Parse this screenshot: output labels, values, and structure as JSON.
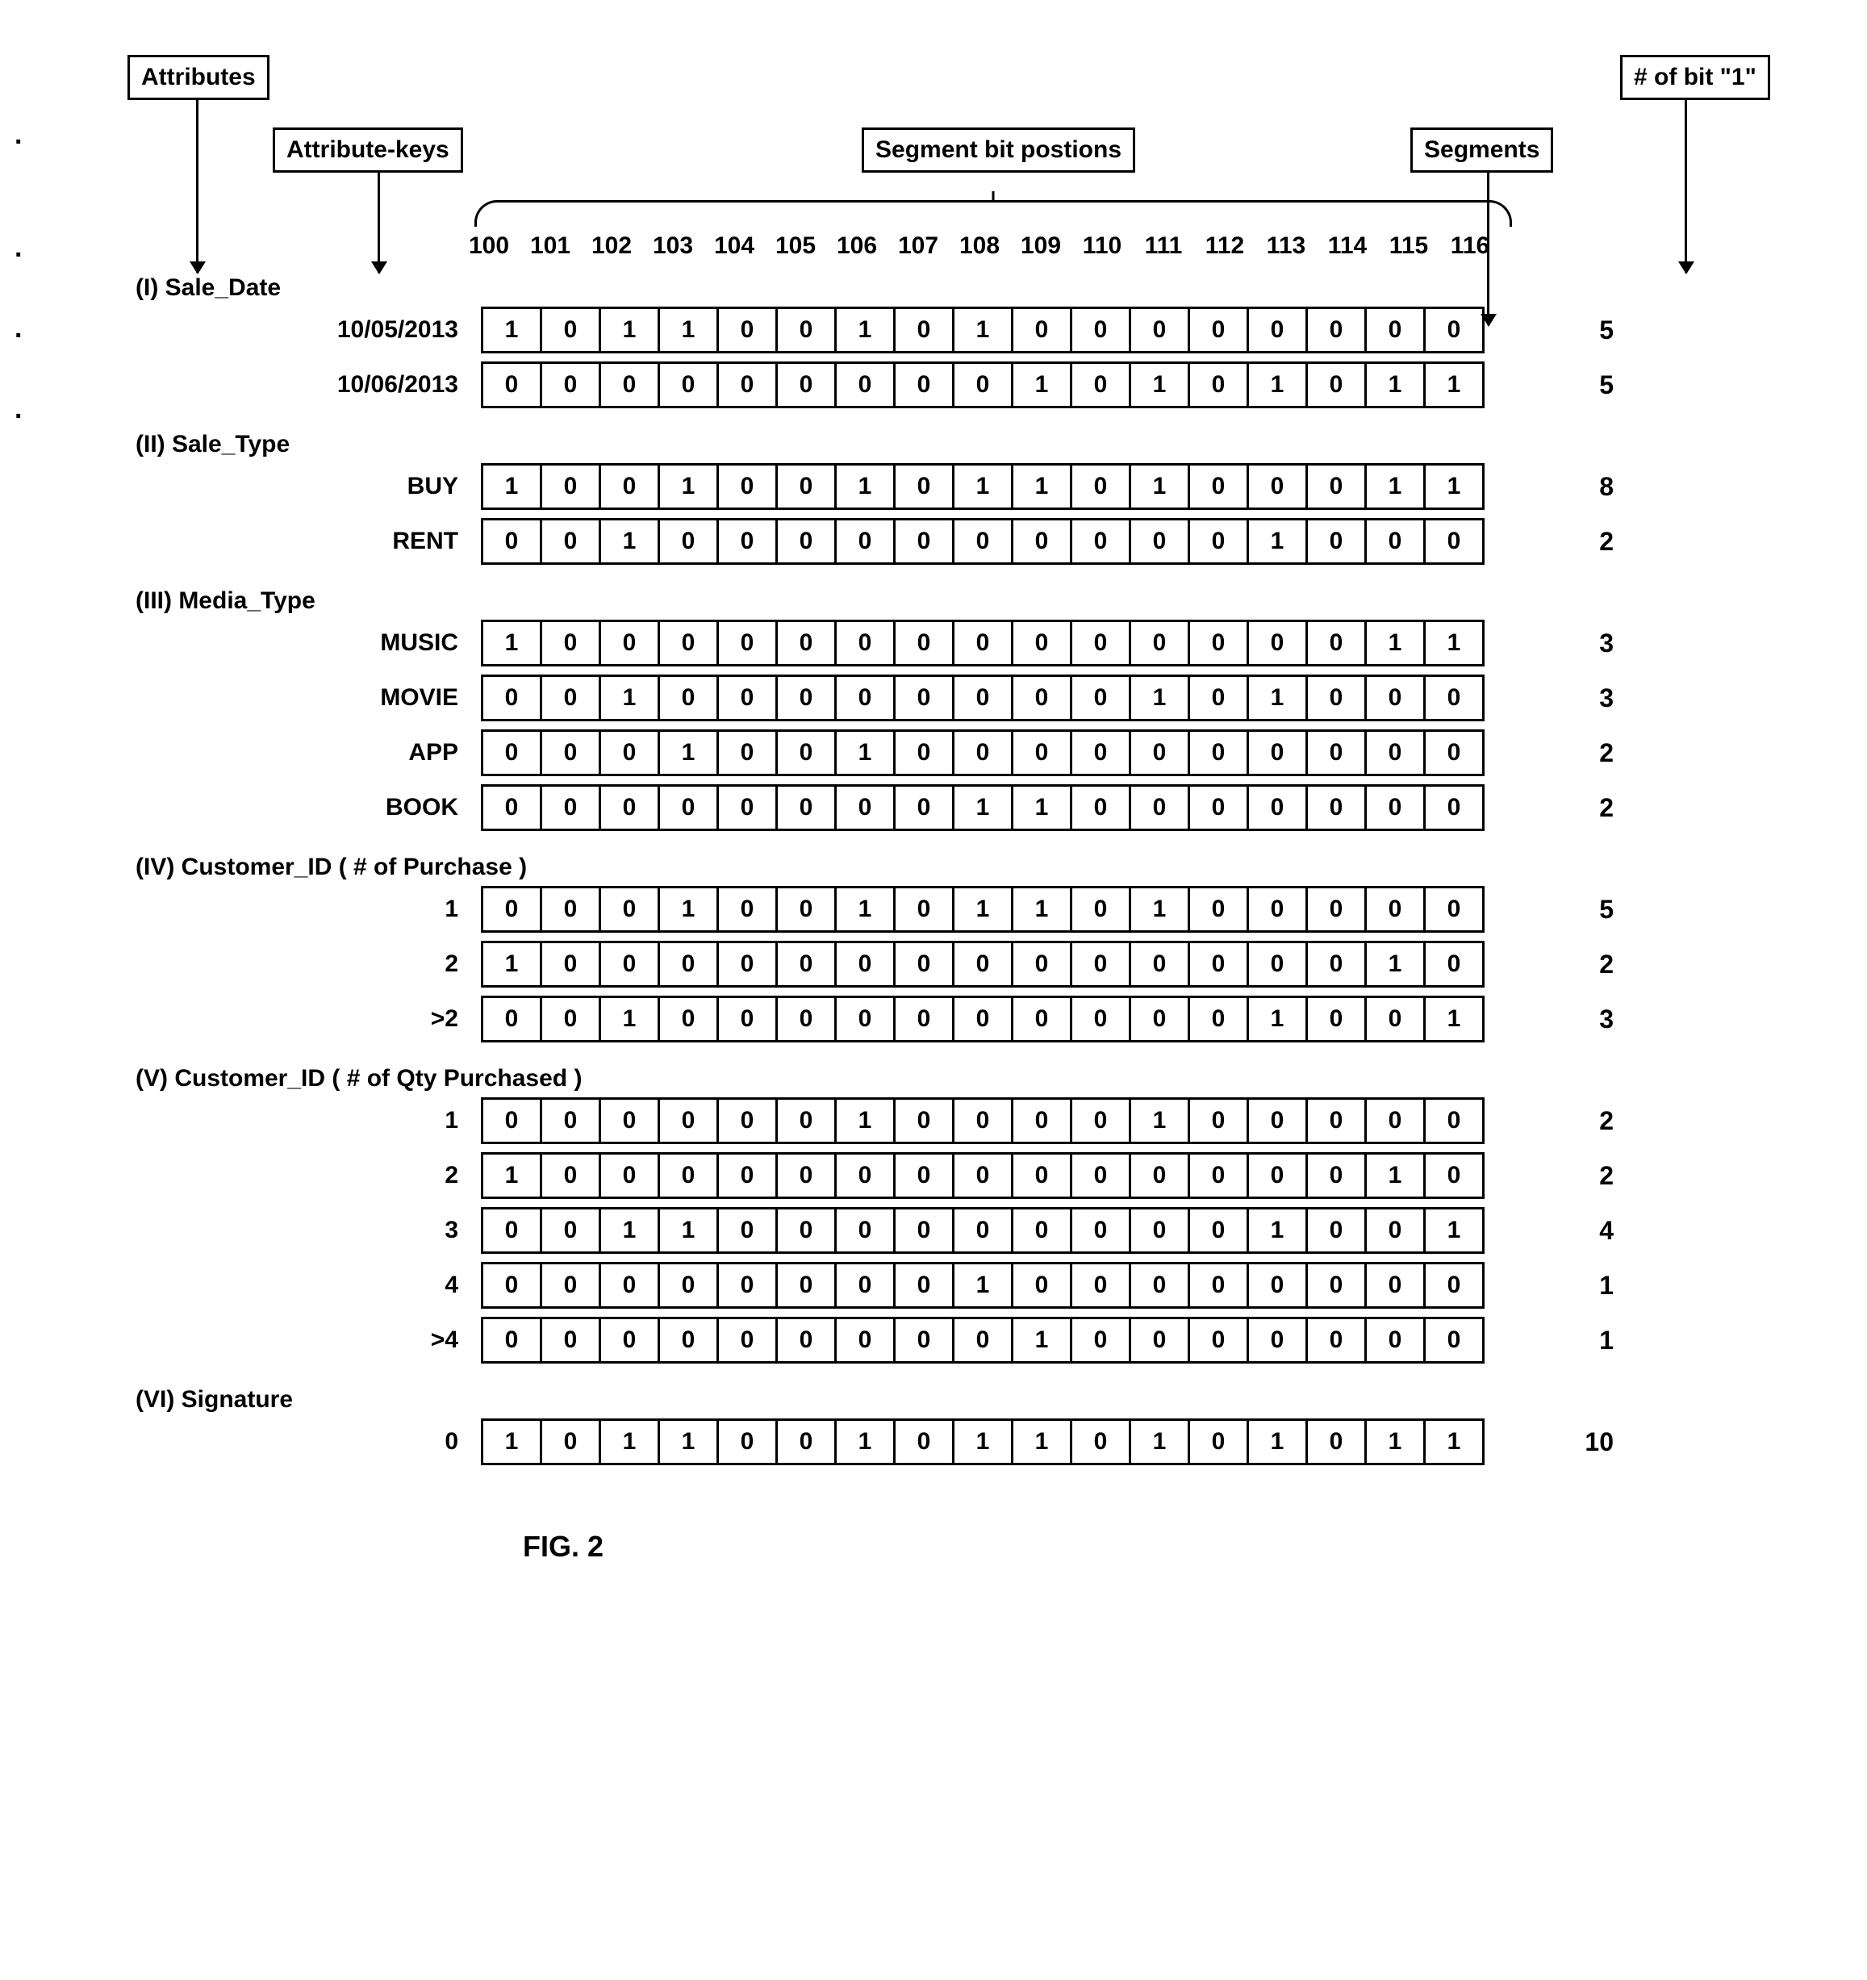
{
  "labels": {
    "attributes": "Attributes",
    "attribute_keys": "Attribute-keys",
    "segment_bit_positions": "Segment bit postions",
    "segments": "Segments",
    "bit_count": "# of bit \"1\""
  },
  "positions": [
    "100",
    "101",
    "102",
    "103",
    "104",
    "105",
    "106",
    "107",
    "108",
    "109",
    "110",
    "111",
    "112",
    "113",
    "114",
    "115",
    "116"
  ],
  "groups": [
    {
      "title": "(I) Sale_Date",
      "rows": [
        {
          "key": "10/05/2013",
          "bits": [
            1,
            0,
            1,
            1,
            0,
            0,
            1,
            0,
            1,
            0,
            0,
            0,
            0,
            0,
            0,
            0,
            0
          ],
          "count": 5
        },
        {
          "key": "10/06/2013",
          "bits": [
            0,
            0,
            0,
            0,
            0,
            0,
            0,
            0,
            0,
            1,
            0,
            1,
            0,
            1,
            0,
            1,
            1
          ],
          "count": 5
        }
      ]
    },
    {
      "title": "(II) Sale_Type",
      "rows": [
        {
          "key": "BUY",
          "bits": [
            1,
            0,
            0,
            1,
            0,
            0,
            1,
            0,
            1,
            1,
            0,
            1,
            0,
            0,
            0,
            1,
            1
          ],
          "count": 8
        },
        {
          "key": "RENT",
          "bits": [
            0,
            0,
            1,
            0,
            0,
            0,
            0,
            0,
            0,
            0,
            0,
            0,
            0,
            1,
            0,
            0,
            0
          ],
          "count": 2
        }
      ]
    },
    {
      "title": "(III) Media_Type",
      "rows": [
        {
          "key": "MUSIC",
          "bits": [
            1,
            0,
            0,
            0,
            0,
            0,
            0,
            0,
            0,
            0,
            0,
            0,
            0,
            0,
            0,
            1,
            1
          ],
          "count": 3
        },
        {
          "key": "MOVIE",
          "bits": [
            0,
            0,
            1,
            0,
            0,
            0,
            0,
            0,
            0,
            0,
            0,
            1,
            0,
            1,
            0,
            0,
            0
          ],
          "count": 3
        },
        {
          "key": "APP",
          "bits": [
            0,
            0,
            0,
            1,
            0,
            0,
            1,
            0,
            0,
            0,
            0,
            0,
            0,
            0,
            0,
            0,
            0
          ],
          "count": 2
        },
        {
          "key": "BOOK",
          "bits": [
            0,
            0,
            0,
            0,
            0,
            0,
            0,
            0,
            1,
            1,
            0,
            0,
            0,
            0,
            0,
            0,
            0
          ],
          "count": 2
        }
      ]
    },
    {
      "title": "(IV) Customer_ID ( # of Purchase )",
      "rows": [
        {
          "key": "1",
          "bits": [
            0,
            0,
            0,
            1,
            0,
            0,
            1,
            0,
            1,
            1,
            0,
            1,
            0,
            0,
            0,
            0,
            0
          ],
          "count": 5
        },
        {
          "key": "2",
          "bits": [
            1,
            0,
            0,
            0,
            0,
            0,
            0,
            0,
            0,
            0,
            0,
            0,
            0,
            0,
            0,
            1,
            0
          ],
          "count": 2
        },
        {
          "key": ">2",
          "bits": [
            0,
            0,
            1,
            0,
            0,
            0,
            0,
            0,
            0,
            0,
            0,
            0,
            0,
            1,
            0,
            0,
            1
          ],
          "count": 3
        }
      ]
    },
    {
      "title": "(V) Customer_ID ( # of Qty Purchased )",
      "rows": [
        {
          "key": "1",
          "bits": [
            0,
            0,
            0,
            0,
            0,
            0,
            1,
            0,
            0,
            0,
            0,
            1,
            0,
            0,
            0,
            0,
            0
          ],
          "count": 2
        },
        {
          "key": "2",
          "bits": [
            1,
            0,
            0,
            0,
            0,
            0,
            0,
            0,
            0,
            0,
            0,
            0,
            0,
            0,
            0,
            1,
            0
          ],
          "count": 2
        },
        {
          "key": "3",
          "bits": [
            0,
            0,
            1,
            1,
            0,
            0,
            0,
            0,
            0,
            0,
            0,
            0,
            0,
            1,
            0,
            0,
            1
          ],
          "count": 4
        },
        {
          "key": "4",
          "bits": [
            0,
            0,
            0,
            0,
            0,
            0,
            0,
            0,
            1,
            0,
            0,
            0,
            0,
            0,
            0,
            0,
            0
          ],
          "count": 1
        },
        {
          "key": ">4",
          "bits": [
            0,
            0,
            0,
            0,
            0,
            0,
            0,
            0,
            0,
            1,
            0,
            0,
            0,
            0,
            0,
            0,
            0
          ],
          "count": 1
        }
      ]
    },
    {
      "title": "(VI) Signature",
      "rows": [
        {
          "key": "0",
          "bits": [
            1,
            0,
            1,
            1,
            0,
            0,
            1,
            0,
            1,
            1,
            0,
            1,
            0,
            1,
            0,
            1,
            1
          ],
          "count": 10
        }
      ]
    }
  ],
  "figure_caption": "FIG. 2",
  "chart_data": {
    "type": "table",
    "title": "Segment bitmap by attribute / attribute-key",
    "columns": [
      "100",
      "101",
      "102",
      "103",
      "104",
      "105",
      "106",
      "107",
      "108",
      "109",
      "110",
      "111",
      "112",
      "113",
      "114",
      "115",
      "116",
      "# of bit \"1\""
    ],
    "rows": [
      {
        "attribute": "Sale_Date",
        "key": "10/05/2013",
        "bits": [
          1,
          0,
          1,
          1,
          0,
          0,
          1,
          0,
          1,
          0,
          0,
          0,
          0,
          0,
          0,
          0,
          0
        ],
        "ones": 5
      },
      {
        "attribute": "Sale_Date",
        "key": "10/06/2013",
        "bits": [
          0,
          0,
          0,
          0,
          0,
          0,
          0,
          0,
          0,
          1,
          0,
          1,
          0,
          1,
          0,
          1,
          1
        ],
        "ones": 5
      },
      {
        "attribute": "Sale_Type",
        "key": "BUY",
        "bits": [
          1,
          0,
          0,
          1,
          0,
          0,
          1,
          0,
          1,
          1,
          0,
          1,
          0,
          0,
          0,
          1,
          1
        ],
        "ones": 8
      },
      {
        "attribute": "Sale_Type",
        "key": "RENT",
        "bits": [
          0,
          0,
          1,
          0,
          0,
          0,
          0,
          0,
          0,
          0,
          0,
          0,
          0,
          1,
          0,
          0,
          0
        ],
        "ones": 2
      },
      {
        "attribute": "Media_Type",
        "key": "MUSIC",
        "bits": [
          1,
          0,
          0,
          0,
          0,
          0,
          0,
          0,
          0,
          0,
          0,
          0,
          0,
          0,
          0,
          1,
          1
        ],
        "ones": 3
      },
      {
        "attribute": "Media_Type",
        "key": "MOVIE",
        "bits": [
          0,
          0,
          1,
          0,
          0,
          0,
          0,
          0,
          0,
          0,
          0,
          1,
          0,
          1,
          0,
          0,
          0
        ],
        "ones": 3
      },
      {
        "attribute": "Media_Type",
        "key": "APP",
        "bits": [
          0,
          0,
          0,
          1,
          0,
          0,
          1,
          0,
          0,
          0,
          0,
          0,
          0,
          0,
          0,
          0,
          0
        ],
        "ones": 2
      },
      {
        "attribute": "Media_Type",
        "key": "BOOK",
        "bits": [
          0,
          0,
          0,
          0,
          0,
          0,
          0,
          0,
          1,
          1,
          0,
          0,
          0,
          0,
          0,
          0,
          0
        ],
        "ones": 2
      },
      {
        "attribute": "Customer_ID (# of Purchase)",
        "key": "1",
        "bits": [
          0,
          0,
          0,
          1,
          0,
          0,
          1,
          0,
          1,
          1,
          0,
          1,
          0,
          0,
          0,
          0,
          0
        ],
        "ones": 5
      },
      {
        "attribute": "Customer_ID (# of Purchase)",
        "key": "2",
        "bits": [
          1,
          0,
          0,
          0,
          0,
          0,
          0,
          0,
          0,
          0,
          0,
          0,
          0,
          0,
          0,
          1,
          0
        ],
        "ones": 2
      },
      {
        "attribute": "Customer_ID (# of Purchase)",
        "key": ">2",
        "bits": [
          0,
          0,
          1,
          0,
          0,
          0,
          0,
          0,
          0,
          0,
          0,
          0,
          0,
          1,
          0,
          0,
          1
        ],
        "ones": 3
      },
      {
        "attribute": "Customer_ID (# of Qty Purchased)",
        "key": "1",
        "bits": [
          0,
          0,
          0,
          0,
          0,
          0,
          1,
          0,
          0,
          0,
          0,
          1,
          0,
          0,
          0,
          0,
          0
        ],
        "ones": 2
      },
      {
        "attribute": "Customer_ID (# of Qty Purchased)",
        "key": "2",
        "bits": [
          1,
          0,
          0,
          0,
          0,
          0,
          0,
          0,
          0,
          0,
          0,
          0,
          0,
          0,
          0,
          1,
          0
        ],
        "ones": 2
      },
      {
        "attribute": "Customer_ID (# of Qty Purchased)",
        "key": "3",
        "bits": [
          0,
          0,
          1,
          1,
          0,
          0,
          0,
          0,
          0,
          0,
          0,
          0,
          0,
          1,
          0,
          0,
          1
        ],
        "ones": 4
      },
      {
        "attribute": "Customer_ID (# of Qty Purchased)",
        "key": "4",
        "bits": [
          0,
          0,
          0,
          0,
          0,
          0,
          0,
          0,
          1,
          0,
          0,
          0,
          0,
          0,
          0,
          0,
          0
        ],
        "ones": 1
      },
      {
        "attribute": "Customer_ID (# of Qty Purchased)",
        "key": ">4",
        "bits": [
          0,
          0,
          0,
          0,
          0,
          0,
          0,
          0,
          0,
          1,
          0,
          0,
          0,
          0,
          0,
          0,
          0
        ],
        "ones": 1
      },
      {
        "attribute": "Signature",
        "key": "0",
        "bits": [
          1,
          0,
          1,
          1,
          0,
          0,
          1,
          0,
          1,
          1,
          0,
          1,
          0,
          1,
          0,
          1,
          1
        ],
        "ones": 10
      }
    ]
  }
}
